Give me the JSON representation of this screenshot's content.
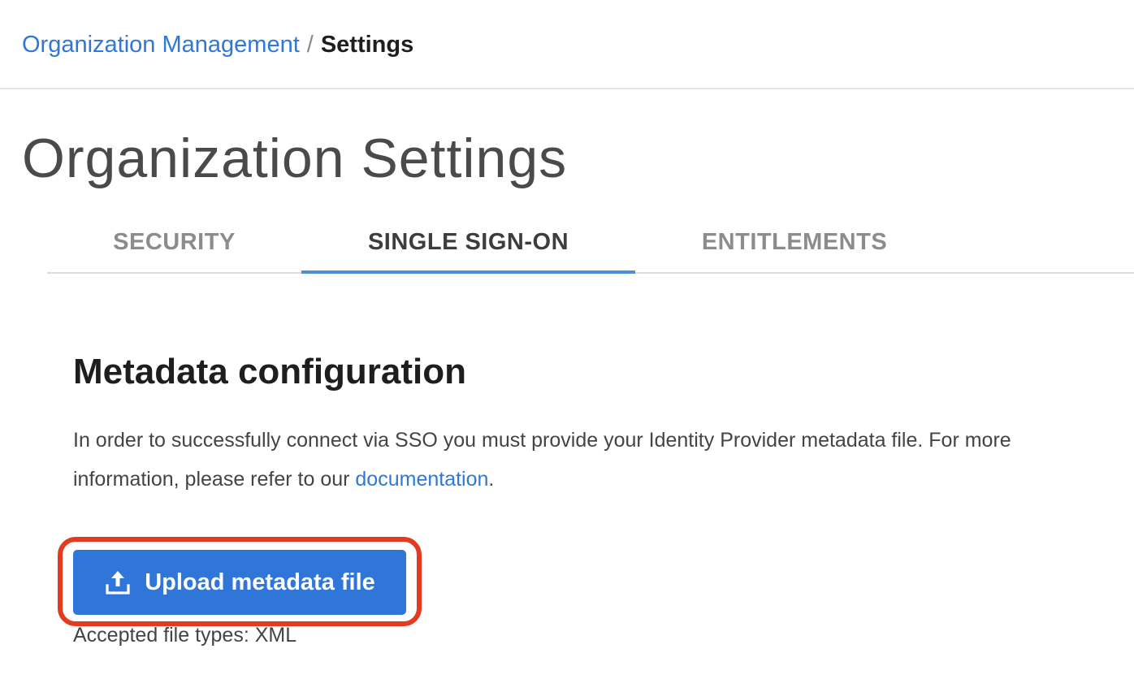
{
  "breadcrumb": {
    "parent": "Organization Management",
    "separator": "/",
    "current": "Settings"
  },
  "page": {
    "title": "Organization Settings"
  },
  "tabs": [
    {
      "label": "SECURITY",
      "active": false
    },
    {
      "label": "SINGLE SIGN-ON",
      "active": true
    },
    {
      "label": "ENTITLEMENTS",
      "active": false
    }
  ],
  "metadata": {
    "heading": "Metadata configuration",
    "description_before_link": "In order to successfully connect via SSO you must provide your Identity Provider metadata file. For more information, please refer to our ",
    "doc_link": "documentation",
    "description_after_link": ".",
    "upload_button_label": "Upload metadata file",
    "upload_icon": "upload-icon",
    "accepted_types": "Accepted file types: XML"
  },
  "colors": {
    "link": "#2f77d8",
    "button": "#2f76d8",
    "highlight": "#e23b22",
    "active_tab_underline": "#4a90d9"
  }
}
